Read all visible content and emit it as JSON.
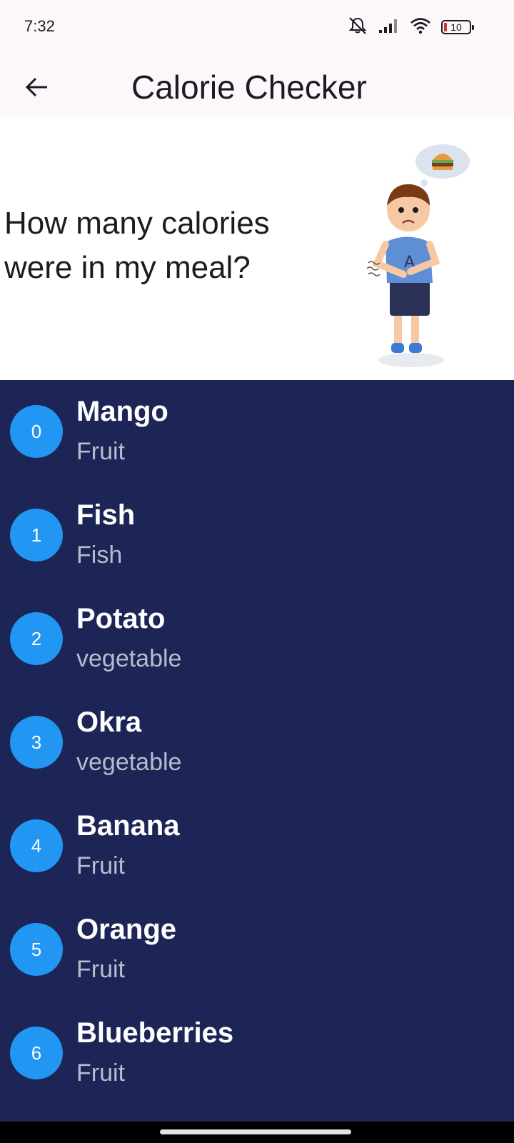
{
  "status_bar": {
    "time": "7:32",
    "battery": "10",
    "icons": [
      "mute-icon",
      "signal-icon",
      "wifi-icon",
      "battery-icon"
    ]
  },
  "app_bar": {
    "title": "Calorie Checker",
    "back_icon": "arrow-back-icon"
  },
  "hero": {
    "question": "How many calories were in my meal?"
  },
  "colors": {
    "list_background": "#1d2557",
    "avatar": "#2196f3",
    "subtitle": "#b7bccd",
    "appbar": "#fdf7fc"
  },
  "items": [
    {
      "index": "0",
      "name": "Mango",
      "category": "Fruit"
    },
    {
      "index": "1",
      "name": "Fish",
      "category": "Fish"
    },
    {
      "index": "2",
      "name": "Potato",
      "category": "vegetable"
    },
    {
      "index": "3",
      "name": "Okra",
      "category": "vegetable"
    },
    {
      "index": "4",
      "name": "Banana",
      "category": "Fruit"
    },
    {
      "index": "5",
      "name": "Orange",
      "category": "Fruit"
    },
    {
      "index": "6",
      "name": "Blueberries",
      "category": "Fruit"
    }
  ]
}
